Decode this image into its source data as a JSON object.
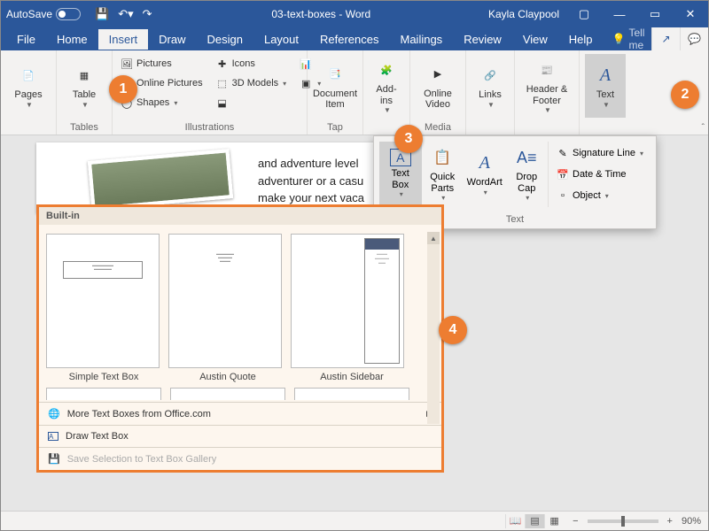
{
  "titlebar": {
    "autosave": "AutoSave",
    "title": "03-text-boxes - Word",
    "user": "Kayla Claypool"
  },
  "tabs": {
    "file": "File",
    "home": "Home",
    "insert": "Insert",
    "draw": "Draw",
    "design": "Design",
    "layout": "Layout",
    "references": "References",
    "mailings": "Mailings",
    "review": "Review",
    "view": "View",
    "help": "Help",
    "tellme": "Tell me"
  },
  "ribbon": {
    "pages": "Pages",
    "table": "Table",
    "tables": "Tables",
    "pictures": "Pictures",
    "online_pictures": "Online Pictures",
    "shapes": "Shapes",
    "icons": "Icons",
    "models3d": "3D Models",
    "illustrations": "Illustrations",
    "document_item": "Document\nItem",
    "tap": "Tap",
    "addins": "Add-\nins",
    "online_video": "Online\nVideo",
    "media": "Media",
    "links": "Links",
    "header_footer": "Header &\nFooter",
    "text": "Text"
  },
  "textpanel": {
    "text_box": "Text\nBox",
    "quick_parts": "Quick\nParts",
    "wordart": "WordArt",
    "drop_cap": "Drop\nCap",
    "signature": "Signature Line",
    "datetime": "Date & Time",
    "object": "Object",
    "label": "Text"
  },
  "doc": {
    "line1": "and adventure level",
    "line2": "adventurer or a casu",
    "line3": "make your next vaca"
  },
  "gallery": {
    "builtin": "Built-in",
    "simple": "Simple Text Box",
    "austin_quote": "Austin Quote",
    "austin_sidebar": "Austin Sidebar",
    "more": "More Text Boxes from Office.com",
    "draw": "Draw Text Box",
    "save_sel": "Save Selection to Text Box Gallery"
  },
  "callouts": {
    "c1": "1",
    "c2": "2",
    "c3": "3",
    "c4": "4"
  },
  "status": {
    "zoom": "90%"
  }
}
